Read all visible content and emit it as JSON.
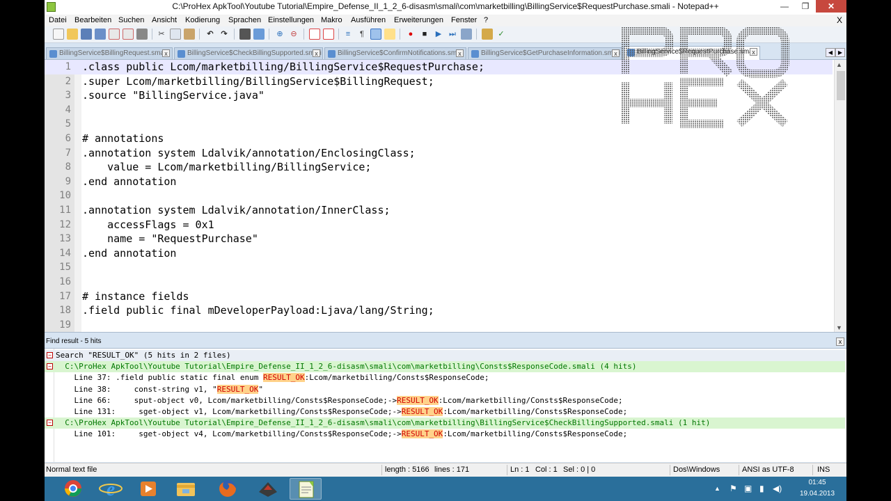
{
  "window": {
    "title": "C:\\ProHex ApkTool\\Youtube Tutorial\\Empire_Defense_II_1_2_6-disasm\\smali\\com\\marketbilling\\BillingService$RequestPurchase.smali - Notepad++",
    "min_glyph": "—",
    "max_glyph": "❐",
    "close_glyph": "✕"
  },
  "menu": {
    "items": [
      "Datei",
      "Bearbeiten",
      "Suchen",
      "Ansicht",
      "Kodierung",
      "Sprachen",
      "Einstellungen",
      "Makro",
      "Ausführen",
      "Erweiterungen",
      "Fenster",
      "?"
    ],
    "close_glyph": "X"
  },
  "tabs": [
    {
      "label": "BillingService$BillingRequest.smali",
      "active": false
    },
    {
      "label": "BillingService$CheckBillingSupported.smali",
      "active": false
    },
    {
      "label": "BillingService$ConfirmNotifications.smali",
      "active": false
    },
    {
      "label": "BillingService$GetPurchaseInformation.smali",
      "active": false
    },
    {
      "label": "BillingService$RequestPurchase.smali",
      "active": true
    }
  ],
  "tab_close_glyph": "x",
  "tab_nav": {
    "left": "◀",
    "right": "▶"
  },
  "editor": {
    "lines": [
      {
        "no": "1",
        "text": ".class public Lcom/marketbilling/BillingService$RequestPurchase;"
      },
      {
        "no": "2",
        "text": ".super Lcom/marketbilling/BillingService$BillingRequest;"
      },
      {
        "no": "3",
        "text": ".source \"BillingService.java\""
      },
      {
        "no": "4",
        "text": ""
      },
      {
        "no": "5",
        "text": ""
      },
      {
        "no": "6",
        "text": "# annotations"
      },
      {
        "no": "7",
        "text": ".annotation system Ldalvik/annotation/EnclosingClass;"
      },
      {
        "no": "8",
        "text": "    value = Lcom/marketbilling/BillingService;"
      },
      {
        "no": "9",
        "text": ".end annotation"
      },
      {
        "no": "10",
        "text": ""
      },
      {
        "no": "11",
        "text": ".annotation system Ldalvik/annotation/InnerClass;"
      },
      {
        "no": "12",
        "text": "    accessFlags = 0x1"
      },
      {
        "no": "13",
        "text": "    name = \"RequestPurchase\""
      },
      {
        "no": "14",
        "text": ".end annotation"
      },
      {
        "no": "15",
        "text": ""
      },
      {
        "no": "16",
        "text": ""
      },
      {
        "no": "17",
        "text": "# instance fields"
      },
      {
        "no": "18",
        "text": ".field public final mDeveloperPayload:Ljava/lang/String;"
      },
      {
        "no": "19",
        "text": ""
      }
    ],
    "current_line": 1,
    "scroll_up": "▲",
    "scroll_down": "▼"
  },
  "watermark": {
    "line1": "PRO",
    "line2": "HEX"
  },
  "find": {
    "title": "Find result - 5 hits",
    "close_glyph": "x",
    "search_line": "Search \"RESULT_OK\" (5 hits in 2 files)",
    "files": [
      {
        "path": "  C:\\ProHex ApkTool\\Youtube Tutorial\\Empire_Defense_II_1_2_6-disasm\\smali\\com\\marketbilling\\Consts$ResponseCode.smali (4 hits)",
        "hits": [
          {
            "pre": "    Line 37: .field public static final enum ",
            "hit": "RESULT_OK",
            "post": ":Lcom/marketbilling/Consts$ResponseCode;"
          },
          {
            "pre": "    Line 38:     const-string v1, \"",
            "hit": "RESULT_OK",
            "post": "\""
          },
          {
            "pre": "    Line 66:     sput-object v0, Lcom/marketbilling/Consts$ResponseCode;->",
            "hit": "RESULT_OK",
            "post": ":Lcom/marketbilling/Consts$ResponseCode;"
          },
          {
            "pre": "    Line 131:     sget-object v1, Lcom/marketbilling/Consts$ResponseCode;->",
            "hit": "RESULT_OK",
            "post": ":Lcom/marketbilling/Consts$ResponseCode;"
          }
        ]
      },
      {
        "path": "  C:\\ProHex ApkTool\\Youtube Tutorial\\Empire_Defense_II_1_2_6-disasm\\smali\\com\\marketbilling\\BillingService$CheckBillingSupported.smali (1 hit)",
        "hits": [
          {
            "pre": "    Line 101:     sget-object v4, Lcom/marketbilling/Consts$ResponseCode;->",
            "hit": "RESULT_OK",
            "post": ":Lcom/marketbilling/Consts$ResponseCode;"
          }
        ]
      }
    ],
    "fold_glyph": "−"
  },
  "status": {
    "file_type": "Normal text file",
    "length": "length : 5166",
    "lines": "lines : 171",
    "ln": "Ln : 1",
    "col": "Col : 1",
    "sel": "Sel : 0 | 0",
    "eol": "Dos\\Windows",
    "encoding": "ANSI as UTF-8",
    "mode": "INS"
  },
  "taskbar": {
    "apps": [
      "chrome-icon",
      "internet-explorer-icon",
      "media-player-icon",
      "file-explorer-icon",
      "firefox-icon",
      "game-icon",
      "notepad-plus-plus-icon"
    ],
    "tray_icons": [
      "▲",
      "⚑",
      "▣",
      "▮",
      "◀)"
    ],
    "time": "01:45",
    "date": "19.04.2013"
  },
  "colors": {
    "title_bar": "#ffffff",
    "close_button": "#c7483e",
    "taskbar": "#2a6f9b",
    "find_file_line": "#d9f5d0",
    "find_hit_text": "#d00000",
    "find_hit_bg": "#ffd28a",
    "current_line": "#e8e8ff"
  }
}
